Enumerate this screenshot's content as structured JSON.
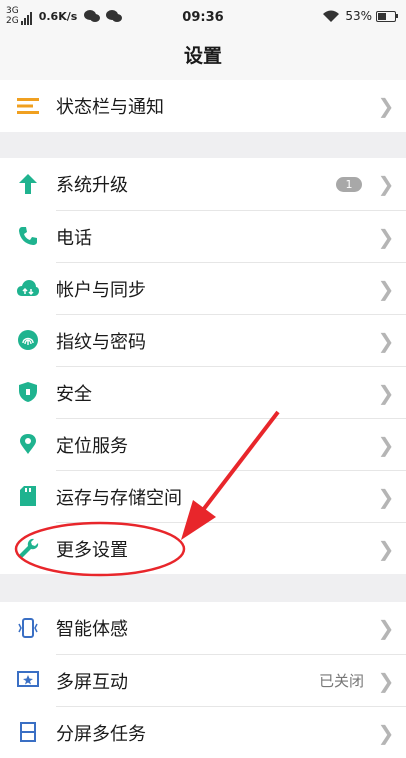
{
  "status_bar": {
    "net_top": "3G",
    "net_bottom": "2G",
    "speed": "0.6K/s",
    "time": "09:36",
    "battery": "53%",
    "battery_level": 0.53
  },
  "header": {
    "title": "设置"
  },
  "group1": {
    "items": [
      {
        "label": "状态栏与通知",
        "icon": "menu-icon"
      }
    ]
  },
  "group2": {
    "items": [
      {
        "label": "系统升级",
        "icon": "arrow-up-icon",
        "badge": "1"
      },
      {
        "label": "电话",
        "icon": "phone-icon"
      },
      {
        "label": "帐户与同步",
        "icon": "cloud-sync-icon"
      },
      {
        "label": "指纹与密码",
        "icon": "fingerprint-icon"
      },
      {
        "label": "安全",
        "icon": "shield-icon"
      },
      {
        "label": "定位服务",
        "icon": "location-pin-icon"
      },
      {
        "label": "运存与存储空间",
        "icon": "sd-card-icon"
      },
      {
        "label": "更多设置",
        "icon": "wrench-icon"
      }
    ]
  },
  "group3": {
    "items": [
      {
        "label": "智能体感",
        "icon": "motion-phone-icon"
      },
      {
        "label": "多屏互动",
        "icon": "screen-cast-icon",
        "value": "已关闭"
      },
      {
        "label": "分屏多任务",
        "icon": "split-screen-icon"
      }
    ]
  },
  "colors": {
    "accent": "#1fb38f",
    "menu_icon": "#f0a020",
    "annotation": "#e8262b"
  }
}
